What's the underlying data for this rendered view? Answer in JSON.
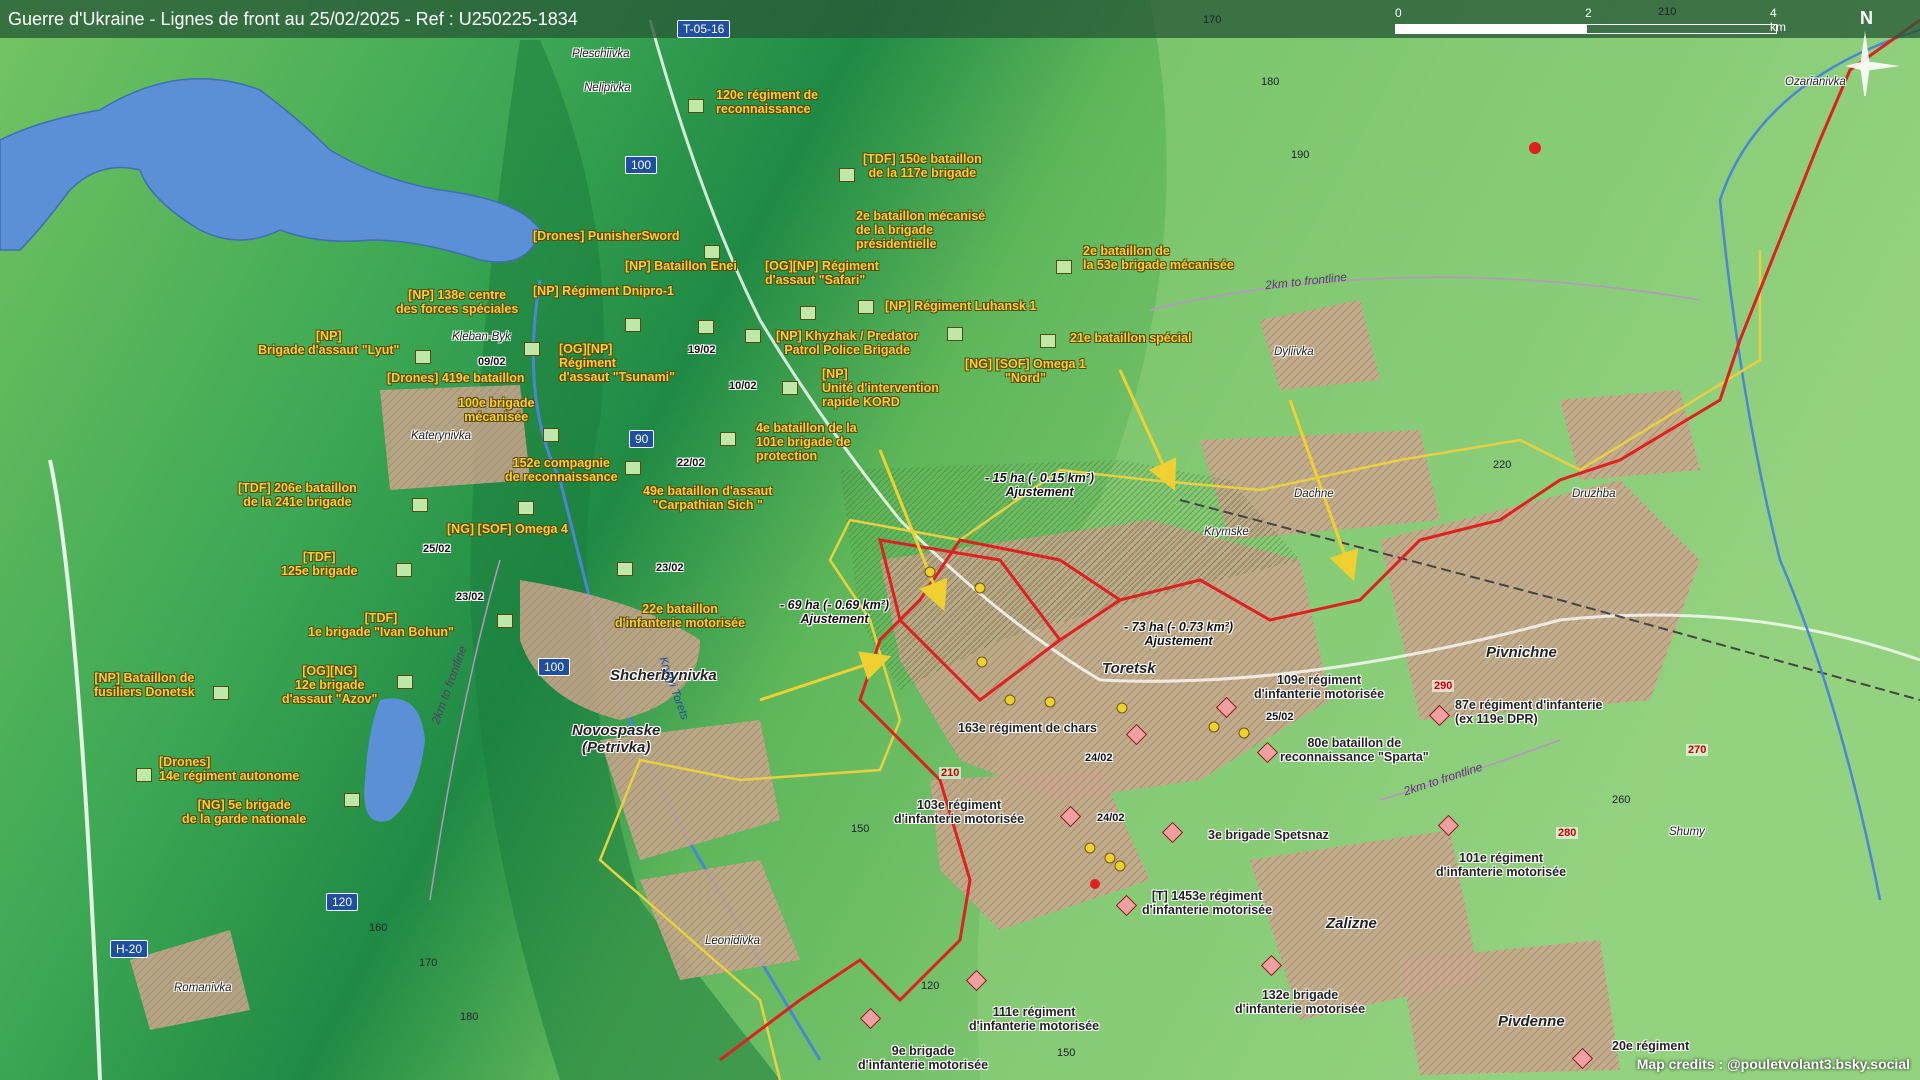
{
  "title": "Guerre d'Ukraine - Lignes de front au 25/02/2025 - Ref : U250225-1834",
  "road_shields": {
    "t0516": "T-05-16",
    "h20": "H-20",
    "r100a": "100",
    "r100b": "100",
    "r90": "90",
    "r120": "120"
  },
  "scale": {
    "t0": "0",
    "t2": "2",
    "t4": "4 km"
  },
  "north": "N",
  "towns": {
    "pleschiivka": "Pleschiivka",
    "nelipivka": "Nelipivka",
    "kleban_byk": "Kleban-Byk",
    "katerynivka": "Katerynivka",
    "shcherbynivka": "Shcherbynivka",
    "novospaske": "Novospaske\n(Petrivka)",
    "leonidivka": "Leonidivka",
    "romanivka": "Romanivka",
    "dyliivka": "Dyliivka",
    "krymske": "Krymske",
    "dachne": "Dachne",
    "druzhba": "Druzhba",
    "toretsk": "Toretsk",
    "pivnichne": "Pivnichne",
    "shumy": "Shumy",
    "zalizne": "Zalizne",
    "pivdenne": "Pivdenne",
    "ozarianivka": "Ozarianivka",
    "kryvyi_torets": "Kryvyi Torets"
  },
  "ua_units": {
    "u1": "120e régiment de\nreconnaissance",
    "u2": "[TDF] 150e bataillon\nde la 117e brigade",
    "u3": "[Drones] PunisherSword",
    "u4": "2e bataillon mécanisé\nde la brigade\nprésidentielle",
    "u5": "2e bataillon de\nla 53e brigade mécanisée",
    "u6": "[NP] Bataillon Enei",
    "u7": "[OG][NP] Régiment\nd'assaut \"Safari\"",
    "u8": "[NP] Régiment Dnipro-1",
    "u9": "[NP] 138e centre\ndes forces spéciales",
    "u10": "[NP] Régiment Luhansk 1",
    "u11": "21e bataillon spécial",
    "u12": "[NP]\nBrigade d'assaut \"Lyut\"",
    "u13": "[NP] Khyzhak / Predator\nPatrol Police Brigade",
    "u14": "[OG][NP]\nRégiment\nd'assaut \"Tsunami\"",
    "u15": "[NG] [SOF] Omega 1\n\"Nord\"",
    "u16": "[Drones] 419e bataillon",
    "u17": "[NP]\nUnité d'intervention\nrapide KORD",
    "u18": "100e brigade\nmécanisée",
    "u19": "4e bataillon de la\n101e brigade de\nprotection",
    "u20": "152e compagnie\nde reconnaissance",
    "u21": "49e bataillon d'assaut\n\"Carpathian Sich \"",
    "u22": "[TDF] 206e bataillon\nde la 241e brigade",
    "u23": "[NG] [SOF] Omega 4",
    "u24": "[TDF]\n125e brigade",
    "u25": "22e bataillon\nd'infanterie motorisée",
    "u26": "[TDF]\n1e brigade \"Ivan Bohun\"",
    "u27": "[NP] Bataillon de\nfusiliers Donetsk",
    "u28": "[OG][NG]\n12e brigade\nd'assaut \"Azov\"",
    "u29": "[Drones]\n14e régiment autonome",
    "u30": "[NG] 5e brigade\nde la garde nationale"
  },
  "ru_units": {
    "r1": "109e régiment\nd'infanterie motorisée",
    "r2": "87e régiment d'infanterie\n(ex 119e DPR)",
    "r3": "163e régiment de chars",
    "r4": "80e bataillon de\nreconnaissance \"Sparta\"",
    "r5": "103e régiment\nd'infanterie motorisée",
    "r6": "3e brigade Spetsnaz",
    "r7": "101e régiment\nd'infanterie motorisée",
    "r8": "[T] 1453e régiment\nd'infanterie motorisée",
    "r9": "132e brigade\nd'infanterie motorisée",
    "r10": "111e régiment\nd'infanterie motorisée",
    "r11": "9e brigade\nd'infanterie motorisée",
    "r12": "20e régiment"
  },
  "dates": {
    "d1": "09/02",
    "d2": "19/02",
    "d3": "10/02",
    "d4": "22/02",
    "d5": "25/02",
    "d6": "23/02",
    "d7": "23/02",
    "d8": "25/02",
    "d9": "24/02",
    "d10": "24/02"
  },
  "area_notes": {
    "a1": "- 15 ha (- 0.15 km²)\nAjustement",
    "a2": "- 69 ha (- 0.69 km²)\nAjustement",
    "a3": "- 73 ha (- 0.73 km²)\nAjustement"
  },
  "frontline_labels": {
    "f1": "2km to frontline",
    "f2": "2km to frontline",
    "f3": "2km to frontline"
  },
  "elevations": {
    "e1": "170",
    "e2": "180",
    "e3": "190",
    "e4": "210",
    "e5": "220",
    "e6": "150",
    "e7": "160",
    "e8": "170",
    "e9": "180",
    "e10": "120",
    "e11": "150",
    "e12": "260",
    "e13": "210",
    "e14": "290",
    "e15": "270",
    "e16": "280"
  },
  "credits": "Map credits : @pouletvolant3.bsky.social",
  "colors": {
    "ukraine_label": "#f5d030",
    "russia_line": "#e02020",
    "ukraine_line": "#e8d040",
    "water": "#5b8fd6",
    "terrain_low": "#2e9a4a",
    "terrain_high": "#8fd07e",
    "urban": "#c8a890"
  }
}
